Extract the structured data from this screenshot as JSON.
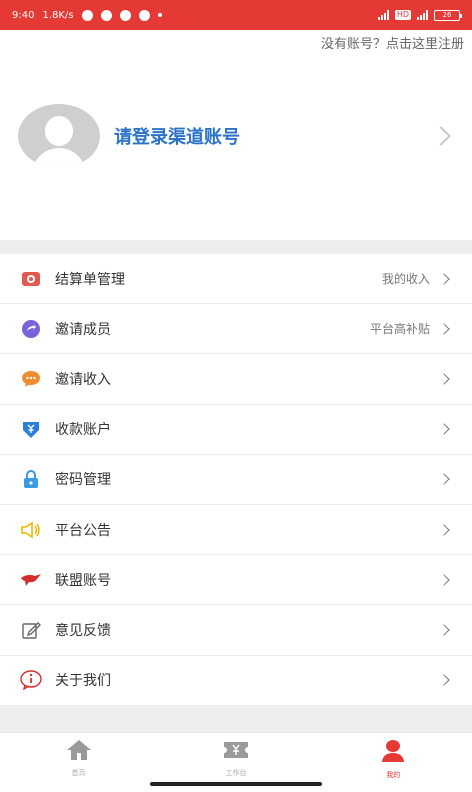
{
  "status_bar": {
    "time": "9:40",
    "speed": "1.8K/s",
    "network_badge": "HD",
    "battery": "26"
  },
  "register_link": "没有账号？点击这里注册",
  "profile": {
    "login_prompt": "请登录渠道账号"
  },
  "menu": [
    {
      "label": "结算单管理",
      "value": "我的收入",
      "icon": "receipt-icon",
      "color": "#e05a52"
    },
    {
      "label": "邀请成员",
      "value": "平台高补贴",
      "icon": "share-icon",
      "color": "#7a63d9"
    },
    {
      "label": "邀请收入",
      "value": "",
      "icon": "chat-bubble-icon",
      "color": "#f08c2e"
    },
    {
      "label": "收款账户",
      "value": "",
      "icon": "wallet-icon",
      "color": "#2a7fd8"
    },
    {
      "label": "密码管理",
      "value": "",
      "icon": "lock-icon",
      "color": "#3a9be0"
    },
    {
      "label": "平台公告",
      "value": "",
      "icon": "speaker-icon",
      "color": "#f2b500"
    },
    {
      "label": "联盟账号",
      "value": "",
      "icon": "bird-icon",
      "color": "#d32f2f"
    },
    {
      "label": "意见反馈",
      "value": "",
      "icon": "edit-icon",
      "color": "#666666"
    },
    {
      "label": "关于我们",
      "value": "",
      "icon": "info-icon",
      "color": "#d32f2f"
    }
  ],
  "tabbar": [
    {
      "label": "首页",
      "icon": "home-icon",
      "active": false
    },
    {
      "label": "工作台",
      "icon": "ticket-icon",
      "active": false
    },
    {
      "label": "我的",
      "icon": "user-icon",
      "active": true
    }
  ]
}
